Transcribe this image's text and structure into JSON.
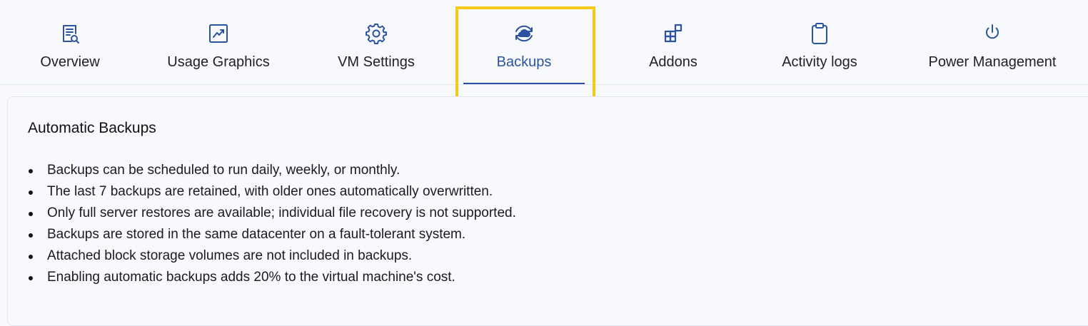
{
  "tabs": [
    {
      "label": "Overview",
      "icon": "document-search-icon"
    },
    {
      "label": "Usage Graphics",
      "icon": "trend-chart-icon"
    },
    {
      "label": "VM Settings",
      "icon": "gear-icon"
    },
    {
      "label": "Backups",
      "icon": "cloud-backup-icon",
      "active": true
    },
    {
      "label": "Addons",
      "icon": "grid-add-icon"
    },
    {
      "label": "Activity logs",
      "icon": "clipboard-icon"
    },
    {
      "label": "Power Management",
      "icon": "power-icon"
    }
  ],
  "panel": {
    "title": "Automatic Backups",
    "items": [
      "Backups can be scheduled to run daily, weekly, or monthly.",
      "The last 7 backups are retained, with older ones automatically overwritten.",
      "Only full server restores are available; individual file recovery is not supported.",
      "Backups are stored in the same datacenter on a fault-tolerant system.",
      "Attached block storage volumes are not included in backups.",
      "Enabling automatic backups adds 20% to the virtual machine's cost."
    ]
  },
  "colors": {
    "accent": "#2b53a1",
    "highlight": "#f6c915",
    "background": "#f8f9fc"
  }
}
